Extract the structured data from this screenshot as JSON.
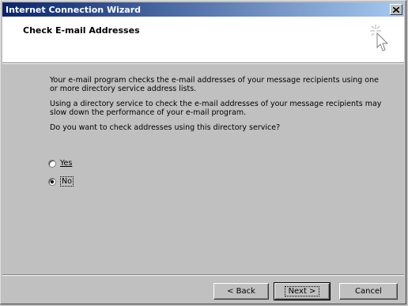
{
  "window": {
    "title": "Internet Connection Wizard"
  },
  "header": {
    "title": "Check E-mail Addresses",
    "icon": "wizard-cursor-icon"
  },
  "content": {
    "paragraph1": "Your e-mail program checks the e-mail addresses of your message recipients using one or more directory service address lists.",
    "paragraph2": "Using a directory service to check the e-mail addresses of your message recipients may slow down the performance of your e-mail program.",
    "question": "Do you want to check addresses using this directory service?"
  },
  "options": {
    "yes_label": "Yes",
    "no_label": "No",
    "selected": "No"
  },
  "buttons": {
    "back": "< Back",
    "next": "Next >",
    "cancel": "Cancel"
  },
  "colors": {
    "titlebar_start": "#0a246a",
    "titlebar_end": "#a6caf0",
    "dialog_bg": "#c0c0c0"
  }
}
